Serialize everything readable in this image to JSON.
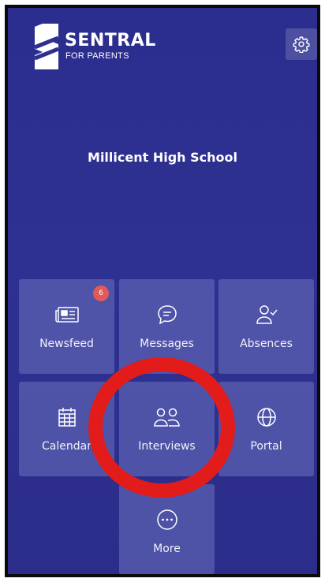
{
  "brand": {
    "name": "SENTRAL",
    "tagline": "FOR PARENTS"
  },
  "school": {
    "name": "Millicent High School"
  },
  "tiles": [
    {
      "label": "Newsfeed",
      "icon": "newspaper-icon",
      "badge": "6"
    },
    {
      "label": "Messages",
      "icon": "chat-bubble-icon"
    },
    {
      "label": "Absences",
      "icon": "user-check-icon"
    },
    {
      "label": "Calendar",
      "icon": "calendar-icon"
    },
    {
      "label": "Interviews",
      "icon": "two-people-icon"
    },
    {
      "label": "Portal",
      "icon": "globe-icon"
    },
    {
      "label": "More",
      "icon": "ellipsis-circle-icon"
    }
  ],
  "annotation": {
    "color": "#e21b1b",
    "target": "Interviews"
  },
  "colors": {
    "background": "#2e3090",
    "tile": "#5a62b8",
    "badge": "#e05a5a"
  }
}
